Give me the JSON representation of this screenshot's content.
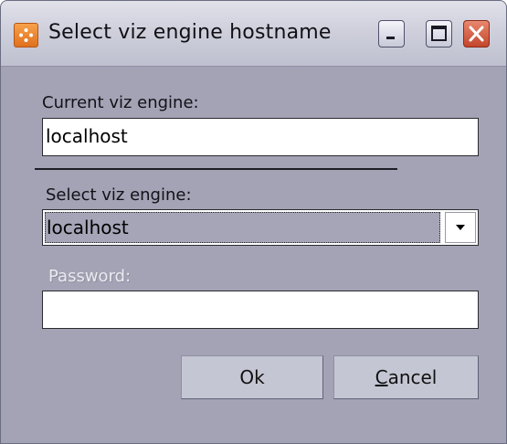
{
  "window": {
    "title": "Select viz engine hostname"
  },
  "titlebar_buttons": {
    "minimize": "minimize-icon",
    "maximize": "maximize-icon",
    "close": "close-icon"
  },
  "current_engine": {
    "label": "Current viz engine:",
    "value": "localhost"
  },
  "select_engine": {
    "label": "Select viz engine:",
    "selected": "localhost"
  },
  "password": {
    "label": "Password:",
    "value": ""
  },
  "buttons": {
    "ok": "Ok",
    "cancel_mnemonic": "C",
    "cancel_rest": "ancel"
  },
  "colors": {
    "window_bg": "#a3a3b5",
    "close_button": "#c3462b",
    "app_icon": "#e0701d"
  }
}
